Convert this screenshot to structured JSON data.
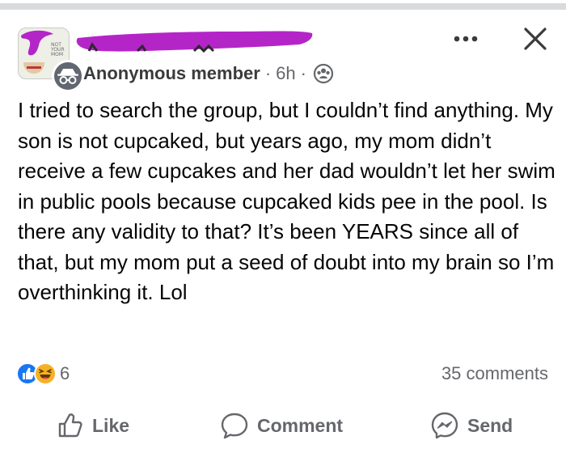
{
  "header": {
    "author": "Anonymous member",
    "separator1": "·",
    "time": "6h",
    "separator2": "·",
    "group_avatar_tiny_text": "NOT YOUR MOM",
    "more_icon": "more-horizontal-icon",
    "close_icon": "close-icon",
    "privacy_icon": "group-privacy-icon"
  },
  "post": {
    "text": "I tried to search the group, but I couldn’t find anything. My son is not cupcaked, but years ago, my mom didn’t receive a few cupcakes and her dad wouldn’t let her swim in public pools because cupcaked kids pee in the pool. Is there any validity to that? It’s been YEARS since all of that, but my mom put a seed of doubt into my brain so I’m overthinking it. Lol"
  },
  "engagement": {
    "reaction_icons": [
      "like-reaction-icon",
      "haha-reaction-icon"
    ],
    "reaction_count": "6",
    "comments": "35 comments"
  },
  "actions": {
    "like": "Like",
    "comment": "Comment",
    "send": "Send"
  },
  "colors": {
    "text": "#050505",
    "secondary": "#65676b",
    "like_blue": "#1877f2",
    "haha_yellow": "#f7b125",
    "redaction_purple": "#b425c8",
    "divider": "#d9dadc"
  }
}
